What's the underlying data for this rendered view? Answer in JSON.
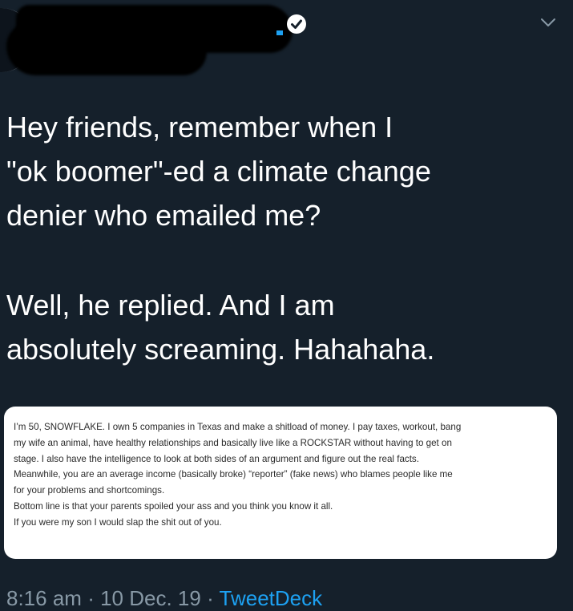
{
  "tweet": {
    "text_lines": [
      "Hey friends, remember when I",
      "\"ok boomer\"-ed a climate change",
      "denier who emailed me?",
      "Well, he replied. And I am",
      "absolutely screaming. Hahahaha."
    ],
    "email_lines": [
      "I’m 50, SNOWFLAKE.  I own 5 companies in Texas and make a shitload of money.  I pay taxes, workout, bang",
      "my wife an animal, have healthy relationships and basically live like a ROCKSTAR without having to get on",
      "stage.  I also have the intelligence to look at both sides of an argument and figure out the real facts.",
      "Meanwhile, you are an average income (basically broke) “reporter” (fake news) who blames people like me",
      "for your problems and shortcomings.",
      "Bottom line is that your parents spoiled your ass and you think you know it all.",
      "If you were my son I would slap the shit out of you."
    ],
    "time": "8:16 am",
    "separator": "·",
    "date": "10 Dec. 19",
    "source": "TweetDeck"
  },
  "icons": {
    "verified": "verified-badge-icon",
    "menu": "chevron-down-icon"
  },
  "colors": {
    "background": "#15202b",
    "text": "#ffffff",
    "meta": "#8899a6",
    "link": "#1da1f2"
  }
}
